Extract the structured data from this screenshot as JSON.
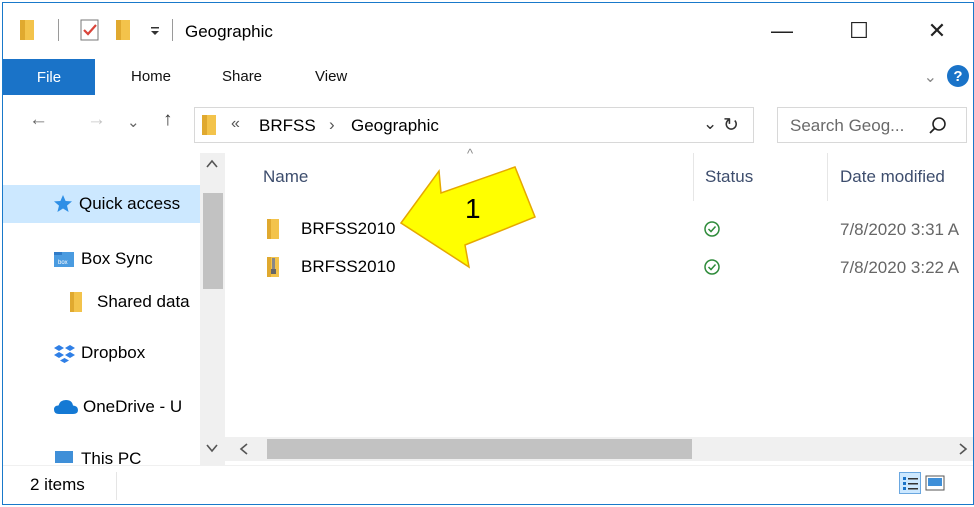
{
  "window": {
    "title": "Geographic",
    "minimize_glyph": "—",
    "maximize_glyph": "☐",
    "close_glyph": "✕"
  },
  "ribbon": {
    "tabs": [
      "File",
      "Home",
      "Share",
      "View"
    ],
    "help_glyph": "?",
    "expand_glyph": "⌄"
  },
  "address": {
    "overflow": "«",
    "breadcrumb": [
      "BRFSS",
      "Geographic"
    ],
    "separator": "›",
    "search_placeholder": "Search Geog..."
  },
  "navigation": {
    "back": "←",
    "forward": "→",
    "recent": "⌄",
    "up": "↑",
    "refresh": "↻",
    "dropdown": "⌄"
  },
  "nav_pane": {
    "items": [
      {
        "label": "Quick access",
        "icon": "star-icon",
        "selected": true
      },
      {
        "label": "Box Sync",
        "icon": "box-folder-icon"
      },
      {
        "label": "Shared data",
        "icon": "folder-icon"
      },
      {
        "label": "Dropbox",
        "icon": "dropbox-icon"
      },
      {
        "label": "OneDrive - U",
        "icon": "cloud-icon"
      },
      {
        "label": "This PC",
        "icon": "computer-icon"
      }
    ]
  },
  "file_list": {
    "columns": {
      "name": "Name",
      "status": "Status",
      "date": "Date modified"
    },
    "sort_glyph": "^",
    "rows": [
      {
        "name": "BRFSS2010",
        "type": "folder",
        "status": "synced",
        "date": "7/8/2020 3:31 A"
      },
      {
        "name": "BRFSS2010",
        "type": "zip",
        "status": "synced",
        "date": "7/8/2020 3:22 A"
      }
    ]
  },
  "status_bar": {
    "item_count": "2 items"
  },
  "callout": {
    "number": "1",
    "color": "#ffff00"
  },
  "colors": {
    "accent": "#1a73c8",
    "folder": "#f3c34b",
    "sync_green": "#2e8b3a",
    "header_text": "#3d4d6d"
  }
}
